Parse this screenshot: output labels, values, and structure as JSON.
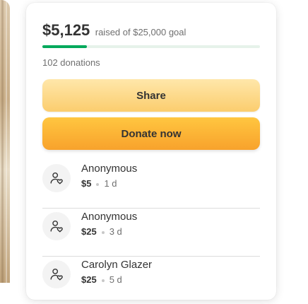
{
  "fundraiser": {
    "raised_amount": "$5,125",
    "raised_text": "raised of $25,000 goal",
    "progress_fraction": 0.205,
    "donation_count": "102 donations"
  },
  "actions": {
    "share_label": "Share",
    "donate_label": "Donate now"
  },
  "donations": [
    {
      "name": "Anonymous",
      "amount": "$5",
      "time": "1 d"
    },
    {
      "name": "Anonymous",
      "amount": "$25",
      "time": "3 d"
    },
    {
      "name": "Carolyn Glazer",
      "amount": "$25",
      "time": "5 d"
    }
  ],
  "icons": {
    "donor": "person-heart-icon"
  },
  "colors": {
    "progress": "#02a95c",
    "donate": "#f8a22c",
    "share": "#fbcd6e"
  }
}
